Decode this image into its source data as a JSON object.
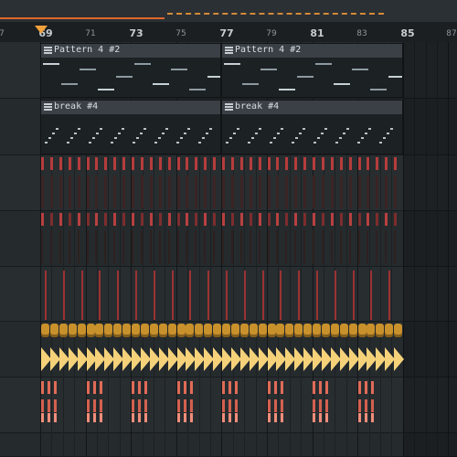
{
  "ruler": {
    "bars": [
      "7",
      "69",
      "71",
      "73",
      "75",
      "77",
      "79",
      "81",
      "83",
      "85",
      "87"
    ],
    "major": [
      "69",
      "73",
      "77",
      "81",
      "85"
    ]
  },
  "clips": [
    {
      "title": "Pattern 4 #2",
      "kind": "melody"
    },
    {
      "title": "Pattern 4 #2",
      "kind": "melody"
    },
    {
      "title": "break #4",
      "kind": "break"
    },
    {
      "title": "break #4",
      "kind": "break"
    }
  ],
  "colors": {
    "loop": "#e0672d",
    "loop_dash": "#d38a37",
    "marker": "#f2a03a",
    "red": "#d24a4a",
    "salmon": "#e57a62",
    "gold": "#c9912c",
    "triangle": "#f5d27a"
  }
}
